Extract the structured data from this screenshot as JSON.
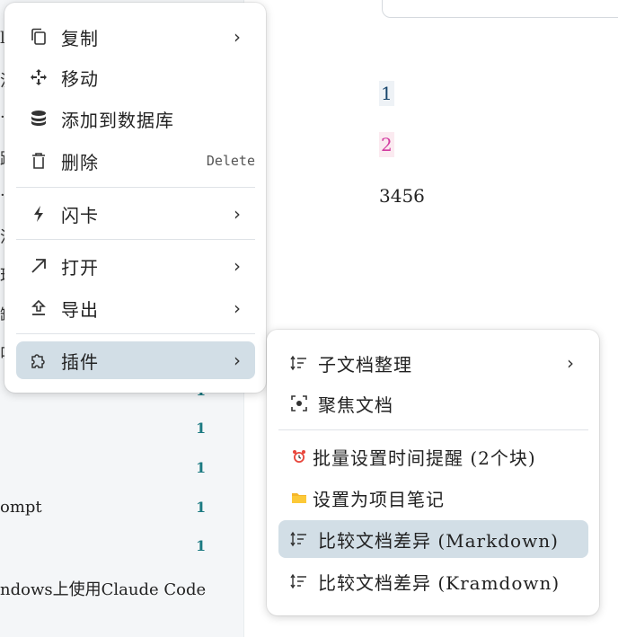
{
  "left_list": {
    "edge_chars": [
      "l",
      "汶",
      "·",
      "踪",
      "·",
      "流",
      "理",
      "缺",
      "叫"
    ],
    "rows": [
      {
        "text": "",
        "count": "1"
      },
      {
        "text": "",
        "count": "1"
      },
      {
        "text": "",
        "count": "1"
      },
      {
        "text": "ompt",
        "count": "1"
      },
      {
        "text": "",
        "count": "1"
      },
      {
        "text": "ndows上使用Claude Code",
        "count": ""
      }
    ]
  },
  "editor": {
    "paragraphs": [
      "1",
      "2",
      "3456"
    ]
  },
  "context_menu": {
    "items": [
      {
        "icon": "copy-icon",
        "label": "复制",
        "submenu": true
      },
      {
        "icon": "move-icon",
        "label": "移动",
        "submenu": false
      },
      {
        "icon": "database-icon",
        "label": "添加到数据库",
        "submenu": false
      },
      {
        "icon": "trash-icon",
        "label": "删除",
        "shortcut": "Delete",
        "submenu": false
      },
      {
        "icon": "flash-icon",
        "label": "闪卡",
        "submenu": true
      },
      {
        "icon": "open-arrow-icon",
        "label": "打开",
        "submenu": true
      },
      {
        "icon": "export-icon",
        "label": "导出",
        "submenu": true
      },
      {
        "icon": "plugin-icon",
        "label": "插件",
        "submenu": true,
        "active": true
      }
    ]
  },
  "plugin_submenu": {
    "items": [
      {
        "icon": "sort-icon",
        "label": "子文档整理",
        "submenu": true
      },
      {
        "icon": "focus-icon",
        "label": "聚焦文档",
        "submenu": false
      },
      {
        "icon": "alarm-clock-icon",
        "label": "批量设置时间提醒 (2个块)",
        "submenu": false
      },
      {
        "icon": "folder-icon",
        "label": "设置为项目笔记",
        "submenu": false
      },
      {
        "icon": "sort-icon",
        "label": "比较文档差异 (Markdown)",
        "submenu": false,
        "active": true
      },
      {
        "icon": "sort-icon",
        "label": "比较文档差异 (Kramdown)",
        "submenu": false
      }
    ]
  },
  "colors": {
    "active_item_bg": "#d2dee6",
    "count_color": "#1c7a82",
    "para2_color": "#d23aa0"
  }
}
